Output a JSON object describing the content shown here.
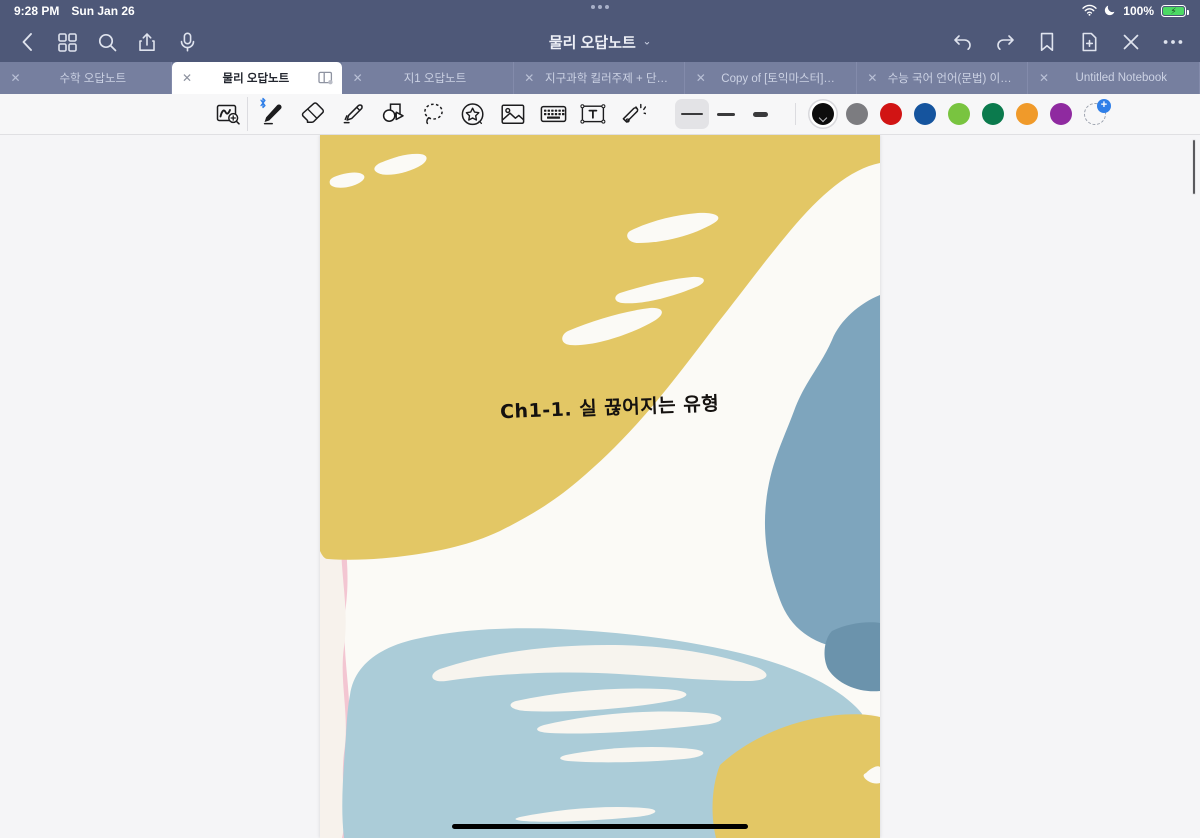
{
  "status_bar": {
    "time": "9:28 PM",
    "date": "Sun Jan 26",
    "battery_percent": "100%",
    "icons": [
      "wifi-icon",
      "moon-icon",
      "battery-charging-icon"
    ]
  },
  "nav_bar": {
    "title": "물리 오답노트",
    "title_chevron": "⌄",
    "left_icons": [
      "back-chevron-icon",
      "grid-icon",
      "search-icon",
      "share-icon",
      "microphone-icon"
    ],
    "right_icons": [
      "undo-icon",
      "redo-icon",
      "bookmark-icon",
      "add-page-icon",
      "close-icon",
      "more-icon"
    ]
  },
  "tabs": [
    {
      "label": "수학 오답노트",
      "active": false,
      "close": "✕"
    },
    {
      "label": "물리 오답노트",
      "active": true,
      "close": "✕"
    },
    {
      "label": "지1 오답노트",
      "active": false,
      "close": "✕"
    },
    {
      "label": "지구과학 킬러주제 + 단…",
      "active": false,
      "close": "✕"
    },
    {
      "label": "Copy of [토익마스터]…",
      "active": false,
      "close": "✕"
    },
    {
      "label": "수능 국어 언어(문법) 이…",
      "active": false,
      "close": "✕"
    },
    {
      "label": "Untitled Notebook",
      "active": false,
      "close": "✕"
    }
  ],
  "toolbar": {
    "tools": [
      {
        "name": "zoom-scroll-icon",
        "selected": false
      },
      {
        "name": "pen-icon",
        "selected": true,
        "badge": "bluetooth-icon"
      },
      {
        "name": "eraser-icon",
        "selected": false
      },
      {
        "name": "highlighter-icon",
        "selected": false
      },
      {
        "name": "shapes-icon",
        "selected": false
      },
      {
        "name": "lasso-icon",
        "selected": false
      },
      {
        "name": "sticker-icon",
        "selected": false
      },
      {
        "name": "image-icon",
        "selected": false
      },
      {
        "name": "keyboard-icon",
        "selected": false
      },
      {
        "name": "text-box-icon",
        "selected": false
      },
      {
        "name": "laser-pointer-icon",
        "selected": false
      }
    ],
    "widths": [
      {
        "name": "stroke-width-thin",
        "selected": true,
        "px": 2
      },
      {
        "name": "stroke-width-medium",
        "selected": false,
        "px": 3
      },
      {
        "name": "stroke-width-thick",
        "selected": false,
        "px": 5
      }
    ],
    "colors": [
      {
        "name": "color-black",
        "hex": "#0d0d0d",
        "selected": true
      },
      {
        "name": "color-gray",
        "hex": "#7c7c80",
        "selected": false
      },
      {
        "name": "color-red",
        "hex": "#d11414",
        "selected": false
      },
      {
        "name": "color-blue",
        "hex": "#15549e",
        "selected": false
      },
      {
        "name": "color-light-green",
        "hex": "#79c440",
        "selected": false
      },
      {
        "name": "color-dark-green",
        "hex": "#0b7a4d",
        "selected": false
      },
      {
        "name": "color-orange",
        "hex": "#f09a2a",
        "selected": false
      },
      {
        "name": "color-purple",
        "hex": "#8f2aa0",
        "selected": false
      }
    ],
    "add_color_label": "+"
  },
  "page": {
    "handwriting": "Ch1-1. 실 끊어지는 유형",
    "cover_colors": {
      "paper": "#fbfaf6",
      "yellow": "#e3c765",
      "steel_blue": "#7ea5bd",
      "light_blue": "#abccd8",
      "pink": "#f3c6d2",
      "cream": "#f6f3ea"
    }
  },
  "theme": {
    "chrome": "#4e5878",
    "tab_bar": "#6a7596",
    "tab_inactive": "#767f9f",
    "toolbar": "#f7f7f8",
    "canvas": "#f5f5f7",
    "accent": "#2f7fe8"
  }
}
